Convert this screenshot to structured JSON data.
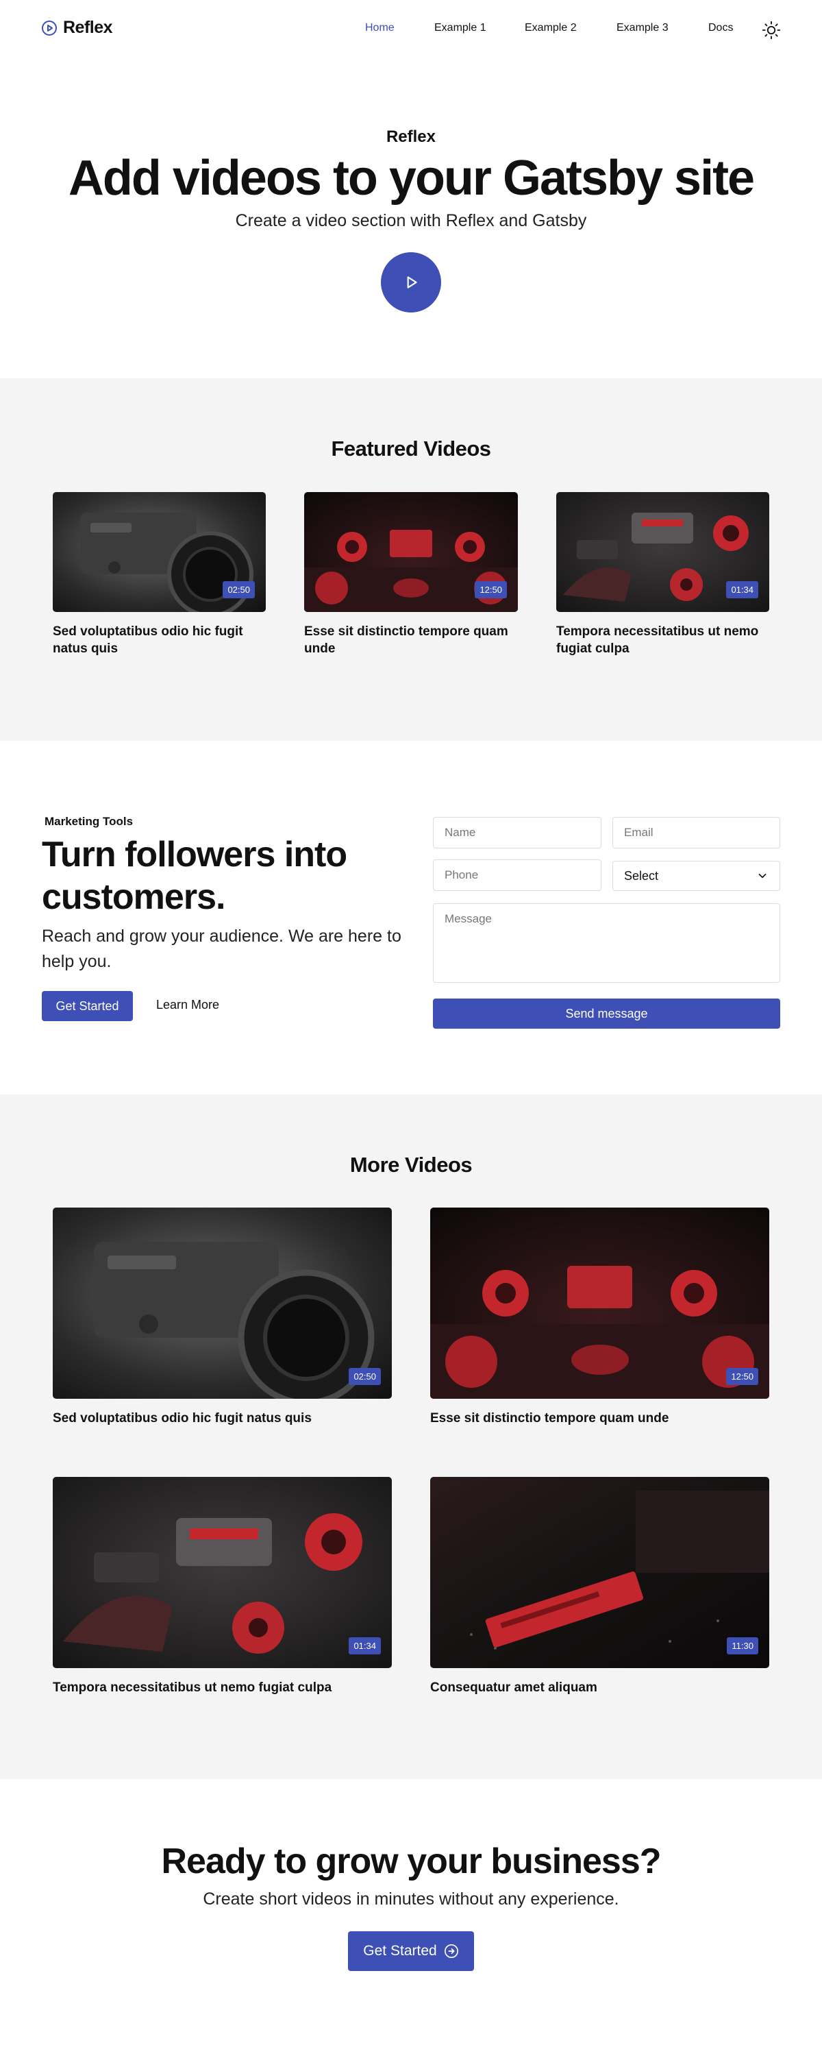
{
  "brand": {
    "name": "Reflex",
    "accent": "#3e4fb5"
  },
  "nav": [
    {
      "label": "Home",
      "active": true
    },
    {
      "label": "Example 1",
      "active": false
    },
    {
      "label": "Example 2",
      "active": false
    },
    {
      "label": "Example 3",
      "active": false
    },
    {
      "label": "Docs",
      "active": false
    }
  ],
  "hero": {
    "kicker": "Reflex",
    "title": "Add videos to your Gatsby site",
    "subtitle": "Create a video section with Reflex and Gatsby"
  },
  "featured": {
    "title": "Featured Videos",
    "videos": [
      {
        "title": "Sed voluptatibus odio hic fugit natus quis",
        "duration": "02:50",
        "thumb": "camera"
      },
      {
        "title": "Esse sit distinctio tempore quam unde",
        "duration": "12:50",
        "thumb": "red-gear"
      },
      {
        "title": "Tempora necessitatibus ut nemo fugiat culpa",
        "duration": "01:34",
        "thumb": "red-parts"
      }
    ]
  },
  "marketing": {
    "kicker": "Marketing Tools",
    "title": "Turn followers into customers.",
    "subtitle": "Reach and grow your audience. We are here to help you.",
    "primary_button": "Get Started",
    "secondary_link": "Learn More"
  },
  "form": {
    "name_placeholder": "Name",
    "email_placeholder": "Email",
    "phone_placeholder": "Phone",
    "select_value": "Select",
    "message_placeholder": "Message",
    "submit_label": "Send message"
  },
  "more": {
    "title": "More Videos",
    "videos": [
      {
        "title": "Sed voluptatibus odio hic fugit natus quis",
        "duration": "02:50",
        "thumb": "camera"
      },
      {
        "title": "Esse sit distinctio tempore quam unde",
        "duration": "12:50",
        "thumb": "red-gear"
      },
      {
        "title": "Tempora necessitatibus ut nemo fugiat culpa",
        "duration": "01:34",
        "thumb": "red-parts"
      },
      {
        "title": "Consequatur amet aliquam",
        "duration": "11:30",
        "thumb": "ssd"
      }
    ]
  },
  "cta": {
    "title": "Ready to grow your business?",
    "subtitle": "Create short videos in minutes without any experience.",
    "button": "Get Started"
  }
}
